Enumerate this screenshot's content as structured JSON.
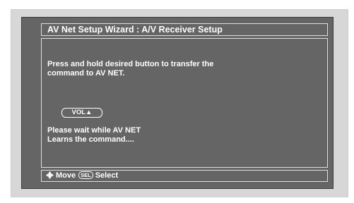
{
  "window": {
    "title": "AV Net Setup Wizard : A/V Receiver Setup"
  },
  "main": {
    "instruction_line1": "Press and hold desired button to transfer the",
    "instruction_line2": "command to AV NET.",
    "button_label": "VOL▲",
    "wait_line1": "Please wait while AV NET",
    "wait_line2": "Learns the command...."
  },
  "footer": {
    "move_icon": "four-way-arrow-icon",
    "move_label": "Move",
    "sel_icon_text": "SEL",
    "select_label": "Select"
  },
  "colors": {
    "screen_bg": "#656565",
    "frame_bg": "#d7d7d7",
    "text": "#ffffff"
  }
}
